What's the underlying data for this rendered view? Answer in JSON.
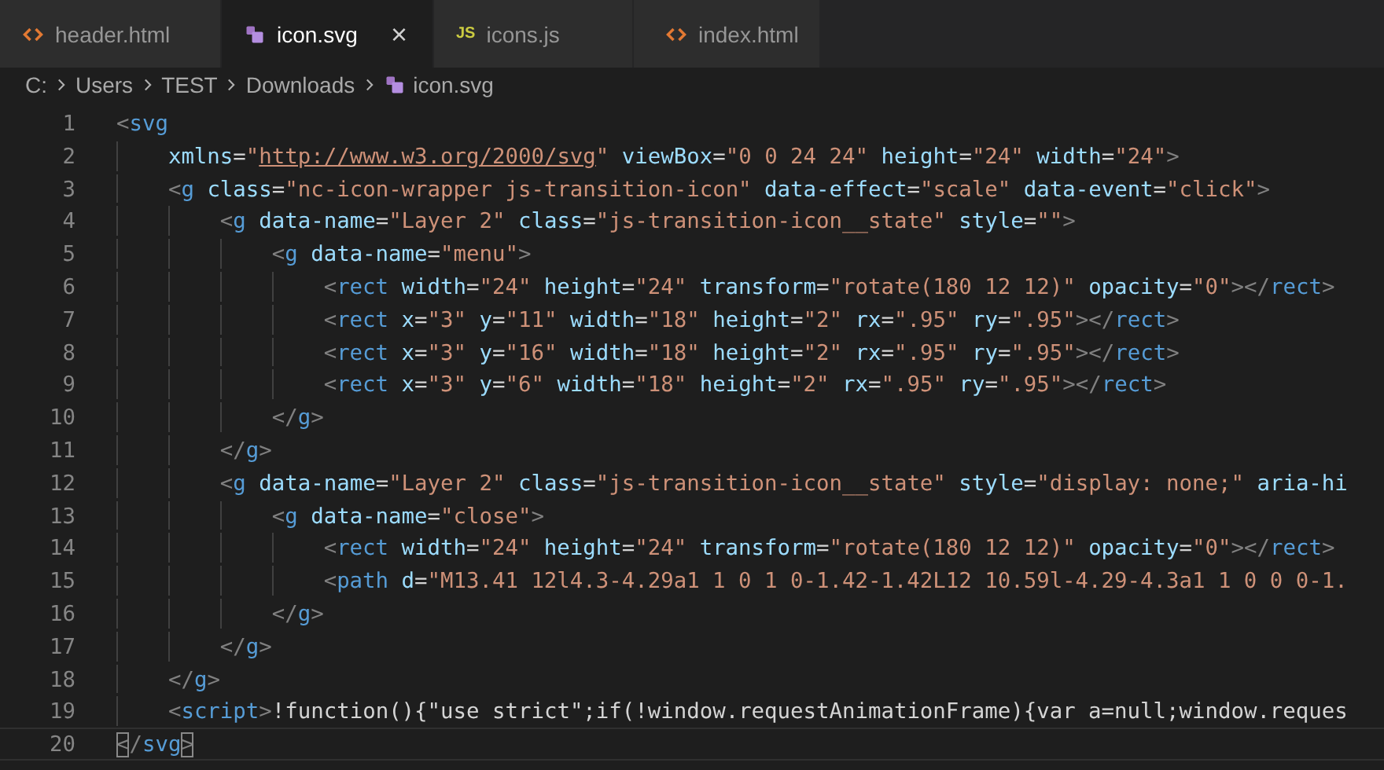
{
  "tabs": [
    {
      "label": "header.html",
      "kind": "html",
      "selected": false
    },
    {
      "label": "icon.svg",
      "kind": "svg",
      "selected": true,
      "close": "×"
    },
    {
      "label": "icons.js",
      "kind": "js",
      "badge": "JS",
      "selected": false
    },
    {
      "label": "index.html",
      "kind": "html",
      "selected": false
    }
  ],
  "breadcrumb": [
    {
      "label": "C:"
    },
    {
      "label": "Users"
    },
    {
      "label": "TEST"
    },
    {
      "label": "Downloads"
    },
    {
      "label": "icon.svg",
      "kind": "svg"
    }
  ],
  "lines": [
    {
      "number": "1",
      "current": false,
      "tokens": [
        {
          "kind": "punct",
          "text": "<"
        },
        {
          "kind": "tag",
          "text": "svg"
        }
      ],
      "children": [
        {
          "number": "2",
          "current": false,
          "tokens": [
            {
              "kind": "attr",
              "text": "xmlns"
            },
            {
              "kind": "text",
              "text": "="
            },
            {
              "kind": "string",
              "text": "\""
            },
            {
              "kind": "url",
              "text": "http://www.w3.org/2000/svg"
            },
            {
              "kind": "string",
              "text": "\" "
            },
            {
              "kind": "attr",
              "text": "viewBox"
            },
            {
              "kind": "text",
              "text": "="
            },
            {
              "kind": "string",
              "text": "\"0 0 24 24\" "
            },
            {
              "kind": "attr",
              "text": "height"
            },
            {
              "kind": "text",
              "text": "="
            },
            {
              "kind": "string",
              "text": "\"24\" "
            },
            {
              "kind": "attr",
              "text": "width"
            },
            {
              "kind": "text",
              "text": "="
            },
            {
              "kind": "string",
              "text": "\"24\""
            },
            {
              "kind": "punct",
              "text": ">"
            }
          ]
        },
        {
          "number": "3",
          "current": false,
          "tokens": [
            {
              "kind": "punct",
              "text": "<"
            },
            {
              "kind": "tag",
              "text": "g "
            },
            {
              "kind": "attr",
              "text": "class"
            },
            {
              "kind": "text",
              "text": "="
            },
            {
              "kind": "string",
              "text": "\"nc-icon-wrapper js-transition-icon\" "
            },
            {
              "kind": "attr",
              "text": "data-effect"
            },
            {
              "kind": "text",
              "text": "="
            },
            {
              "kind": "string",
              "text": "\"scale\" "
            },
            {
              "kind": "attr",
              "text": "data-event"
            },
            {
              "kind": "text",
              "text": "="
            },
            {
              "kind": "string",
              "text": "\"click\""
            },
            {
              "kind": "punct",
              "text": ">"
            }
          ],
          "children": [
            {
              "number": "4",
              "current": false,
              "tokens": [
                {
                  "kind": "punct",
                  "text": "<"
                },
                {
                  "kind": "tag",
                  "text": "g "
                },
                {
                  "kind": "attr",
                  "text": "data-name"
                },
                {
                  "kind": "text",
                  "text": "="
                },
                {
                  "kind": "string",
                  "text": "\"Layer 2\" "
                },
                {
                  "kind": "attr",
                  "text": "class"
                },
                {
                  "kind": "text",
                  "text": "="
                },
                {
                  "kind": "string",
                  "text": "\"js-transition-icon__state\" "
                },
                {
                  "kind": "attr",
                  "text": "style"
                },
                {
                  "kind": "text",
                  "text": "="
                },
                {
                  "kind": "string",
                  "text": "\"\""
                },
                {
                  "kind": "punct",
                  "text": ">"
                }
              ],
              "children": [
                {
                  "number": "5",
                  "current": false,
                  "tokens": [
                    {
                      "kind": "punct",
                      "text": "<"
                    },
                    {
                      "kind": "tag",
                      "text": "g "
                    },
                    {
                      "kind": "attr",
                      "text": "data-name"
                    },
                    {
                      "kind": "text",
                      "text": "="
                    },
                    {
                      "kind": "string",
                      "text": "\"menu\""
                    },
                    {
                      "kind": "punct",
                      "text": ">"
                    }
                  ],
                  "children": [
                    {
                      "number": "6",
                      "current": false,
                      "tokens": [
                        {
                          "kind": "punct",
                          "text": "<"
                        },
                        {
                          "kind": "tag",
                          "text": "rect "
                        },
                        {
                          "kind": "attr",
                          "text": "width"
                        },
                        {
                          "kind": "text",
                          "text": "="
                        },
                        {
                          "kind": "string",
                          "text": "\"24\" "
                        },
                        {
                          "kind": "attr",
                          "text": "height"
                        },
                        {
                          "kind": "text",
                          "text": "="
                        },
                        {
                          "kind": "string",
                          "text": "\"24\" "
                        },
                        {
                          "kind": "attr",
                          "text": "transform"
                        },
                        {
                          "kind": "text",
                          "text": "="
                        },
                        {
                          "kind": "string",
                          "text": "\"rotate(180 12 12)\" "
                        },
                        {
                          "kind": "attr",
                          "text": "opacity"
                        },
                        {
                          "kind": "text",
                          "text": "="
                        },
                        {
                          "kind": "string",
                          "text": "\"0\""
                        },
                        {
                          "kind": "punct",
                          "text": "></"
                        },
                        {
                          "kind": "tag",
                          "text": "rect"
                        },
                        {
                          "kind": "punct",
                          "text": ">"
                        }
                      ]
                    },
                    {
                      "number": "7",
                      "current": false,
                      "tokens": [
                        {
                          "kind": "punct",
                          "text": "<"
                        },
                        {
                          "kind": "tag",
                          "text": "rect "
                        },
                        {
                          "kind": "attr",
                          "text": "x"
                        },
                        {
                          "kind": "text",
                          "text": "="
                        },
                        {
                          "kind": "string",
                          "text": "\"3\" "
                        },
                        {
                          "kind": "attr",
                          "text": "y"
                        },
                        {
                          "kind": "text",
                          "text": "="
                        },
                        {
                          "kind": "string",
                          "text": "\"11\" "
                        },
                        {
                          "kind": "attr",
                          "text": "width"
                        },
                        {
                          "kind": "text",
                          "text": "="
                        },
                        {
                          "kind": "string",
                          "text": "\"18\" "
                        },
                        {
                          "kind": "attr",
                          "text": "height"
                        },
                        {
                          "kind": "text",
                          "text": "="
                        },
                        {
                          "kind": "string",
                          "text": "\"2\" "
                        },
                        {
                          "kind": "attr",
                          "text": "rx"
                        },
                        {
                          "kind": "text",
                          "text": "="
                        },
                        {
                          "kind": "string",
                          "text": "\".95\" "
                        },
                        {
                          "kind": "attr",
                          "text": "ry"
                        },
                        {
                          "kind": "text",
                          "text": "="
                        },
                        {
                          "kind": "string",
                          "text": "\".95\""
                        },
                        {
                          "kind": "punct",
                          "text": "></"
                        },
                        {
                          "kind": "tag",
                          "text": "rect"
                        },
                        {
                          "kind": "punct",
                          "text": ">"
                        }
                      ]
                    },
                    {
                      "number": "8",
                      "current": false,
                      "tokens": [
                        {
                          "kind": "punct",
                          "text": "<"
                        },
                        {
                          "kind": "tag",
                          "text": "rect "
                        },
                        {
                          "kind": "attr",
                          "text": "x"
                        },
                        {
                          "kind": "text",
                          "text": "="
                        },
                        {
                          "kind": "string",
                          "text": "\"3\" "
                        },
                        {
                          "kind": "attr",
                          "text": "y"
                        },
                        {
                          "kind": "text",
                          "text": "="
                        },
                        {
                          "kind": "string",
                          "text": "\"16\" "
                        },
                        {
                          "kind": "attr",
                          "text": "width"
                        },
                        {
                          "kind": "text",
                          "text": "="
                        },
                        {
                          "kind": "string",
                          "text": "\"18\" "
                        },
                        {
                          "kind": "attr",
                          "text": "height"
                        },
                        {
                          "kind": "text",
                          "text": "="
                        },
                        {
                          "kind": "string",
                          "text": "\"2\" "
                        },
                        {
                          "kind": "attr",
                          "text": "rx"
                        },
                        {
                          "kind": "text",
                          "text": "="
                        },
                        {
                          "kind": "string",
                          "text": "\".95\" "
                        },
                        {
                          "kind": "attr",
                          "text": "ry"
                        },
                        {
                          "kind": "text",
                          "text": "="
                        },
                        {
                          "kind": "string",
                          "text": "\".95\""
                        },
                        {
                          "kind": "punct",
                          "text": "></"
                        },
                        {
                          "kind": "tag",
                          "text": "rect"
                        },
                        {
                          "kind": "punct",
                          "text": ">"
                        }
                      ]
                    },
                    {
                      "number": "9",
                      "current": false,
                      "tokens": [
                        {
                          "kind": "punct",
                          "text": "<"
                        },
                        {
                          "kind": "tag",
                          "text": "rect "
                        },
                        {
                          "kind": "attr",
                          "text": "x"
                        },
                        {
                          "kind": "text",
                          "text": "="
                        },
                        {
                          "kind": "string",
                          "text": "\"3\" "
                        },
                        {
                          "kind": "attr",
                          "text": "y"
                        },
                        {
                          "kind": "text",
                          "text": "="
                        },
                        {
                          "kind": "string",
                          "text": "\"6\" "
                        },
                        {
                          "kind": "attr",
                          "text": "width"
                        },
                        {
                          "kind": "text",
                          "text": "="
                        },
                        {
                          "kind": "string",
                          "text": "\"18\" "
                        },
                        {
                          "kind": "attr",
                          "text": "height"
                        },
                        {
                          "kind": "text",
                          "text": "="
                        },
                        {
                          "kind": "string",
                          "text": "\"2\" "
                        },
                        {
                          "kind": "attr",
                          "text": "rx"
                        },
                        {
                          "kind": "text",
                          "text": "="
                        },
                        {
                          "kind": "string",
                          "text": "\".95\" "
                        },
                        {
                          "kind": "attr",
                          "text": "ry"
                        },
                        {
                          "kind": "text",
                          "text": "="
                        },
                        {
                          "kind": "string",
                          "text": "\".95\""
                        },
                        {
                          "kind": "punct",
                          "text": "></"
                        },
                        {
                          "kind": "tag",
                          "text": "rect"
                        },
                        {
                          "kind": "punct",
                          "text": ">"
                        }
                      ]
                    }
                  ]
                },
                {
                  "number": "10",
                  "current": false,
                  "tokens": [
                    {
                      "kind": "punct",
                      "text": "</"
                    },
                    {
                      "kind": "tag",
                      "text": "g"
                    },
                    {
                      "kind": "punct",
                      "text": ">"
                    }
                  ]
                }
              ]
            },
            {
              "number": "11",
              "current": false,
              "tokens": [
                {
                  "kind": "punct",
                  "text": "</"
                },
                {
                  "kind": "tag",
                  "text": "g"
                },
                {
                  "kind": "punct",
                  "text": ">"
                }
              ]
            },
            {
              "number": "12",
              "current": false,
              "tokens": [
                {
                  "kind": "punct",
                  "text": "<"
                },
                {
                  "kind": "tag",
                  "text": "g "
                },
                {
                  "kind": "attr",
                  "text": "data-name"
                },
                {
                  "kind": "text",
                  "text": "="
                },
                {
                  "kind": "string",
                  "text": "\"Layer 2\" "
                },
                {
                  "kind": "attr",
                  "text": "class"
                },
                {
                  "kind": "text",
                  "text": "="
                },
                {
                  "kind": "string",
                  "text": "\"js-transition-icon__state\" "
                },
                {
                  "kind": "attr",
                  "text": "style"
                },
                {
                  "kind": "text",
                  "text": "="
                },
                {
                  "kind": "string",
                  "text": "\"display: none;\" "
                },
                {
                  "kind": "attr",
                  "text": "aria-hi"
                }
              ],
              "children": [
                {
                  "number": "13",
                  "current": false,
                  "tokens": [
                    {
                      "kind": "punct",
                      "text": "<"
                    },
                    {
                      "kind": "tag",
                      "text": "g "
                    },
                    {
                      "kind": "attr",
                      "text": "data-name"
                    },
                    {
                      "kind": "text",
                      "text": "="
                    },
                    {
                      "kind": "string",
                      "text": "\"close\""
                    },
                    {
                      "kind": "punct",
                      "text": ">"
                    }
                  ],
                  "children": [
                    {
                      "number": "14",
                      "current": false,
                      "tokens": [
                        {
                          "kind": "punct",
                          "text": "<"
                        },
                        {
                          "kind": "tag",
                          "text": "rect "
                        },
                        {
                          "kind": "attr",
                          "text": "width"
                        },
                        {
                          "kind": "text",
                          "text": "="
                        },
                        {
                          "kind": "string",
                          "text": "\"24\" "
                        },
                        {
                          "kind": "attr",
                          "text": "height"
                        },
                        {
                          "kind": "text",
                          "text": "="
                        },
                        {
                          "kind": "string",
                          "text": "\"24\" "
                        },
                        {
                          "kind": "attr",
                          "text": "transform"
                        },
                        {
                          "kind": "text",
                          "text": "="
                        },
                        {
                          "kind": "string",
                          "text": "\"rotate(180 12 12)\" "
                        },
                        {
                          "kind": "attr",
                          "text": "opacity"
                        },
                        {
                          "kind": "text",
                          "text": "="
                        },
                        {
                          "kind": "string",
                          "text": "\"0\""
                        },
                        {
                          "kind": "punct",
                          "text": "></"
                        },
                        {
                          "kind": "tag",
                          "text": "rect"
                        },
                        {
                          "kind": "punct",
                          "text": ">"
                        }
                      ]
                    },
                    {
                      "number": "15",
                      "current": false,
                      "tokens": [
                        {
                          "kind": "punct",
                          "text": "<"
                        },
                        {
                          "kind": "tag",
                          "text": "path "
                        },
                        {
                          "kind": "attr",
                          "text": "d"
                        },
                        {
                          "kind": "text",
                          "text": "="
                        },
                        {
                          "kind": "string",
                          "text": "\"M13.41 12l4.3-4.29a1 1 0 1 0-1.42-1.42L12 10.59l-4.29-4.3a1 1 0 0 0-1."
                        }
                      ]
                    }
                  ]
                },
                {
                  "number": "16",
                  "current": false,
                  "tokens": [
                    {
                      "kind": "punct",
                      "text": "</"
                    },
                    {
                      "kind": "tag",
                      "text": "g"
                    },
                    {
                      "kind": "punct",
                      "text": ">"
                    }
                  ]
                }
              ]
            },
            {
              "number": "17",
              "current": false,
              "tokens": [
                {
                  "kind": "punct",
                  "text": "</"
                },
                {
                  "kind": "tag",
                  "text": "g"
                },
                {
                  "kind": "punct",
                  "text": ">"
                }
              ]
            }
          ]
        },
        {
          "number": "18",
          "current": false,
          "tokens": [
            {
              "kind": "punct",
              "text": "</"
            },
            {
              "kind": "tag",
              "text": "g"
            },
            {
              "kind": "punct",
              "text": ">"
            }
          ]
        },
        {
          "number": "19",
          "current": false,
          "tokens": [
            {
              "kind": "punct",
              "text": "<"
            },
            {
              "kind": "tag",
              "text": "script"
            },
            {
              "kind": "punct",
              "text": ">"
            },
            {
              "kind": "text",
              "text": "!function(){\"use strict\";if(!window.requestAnimationFrame){var a=null;window.reques"
            }
          ]
        }
      ]
    },
    {
      "number": "20",
      "current": true,
      "tokens": [
        {
          "kind": "punct",
          "text": "<",
          "matched": true
        },
        {
          "kind": "punct",
          "text": "/",
          "matched": false
        },
        {
          "kind": "tag",
          "text": "svg",
          "matched": false
        },
        {
          "kind": "punct",
          "text": ">",
          "matched": true
        }
      ]
    }
  ]
}
